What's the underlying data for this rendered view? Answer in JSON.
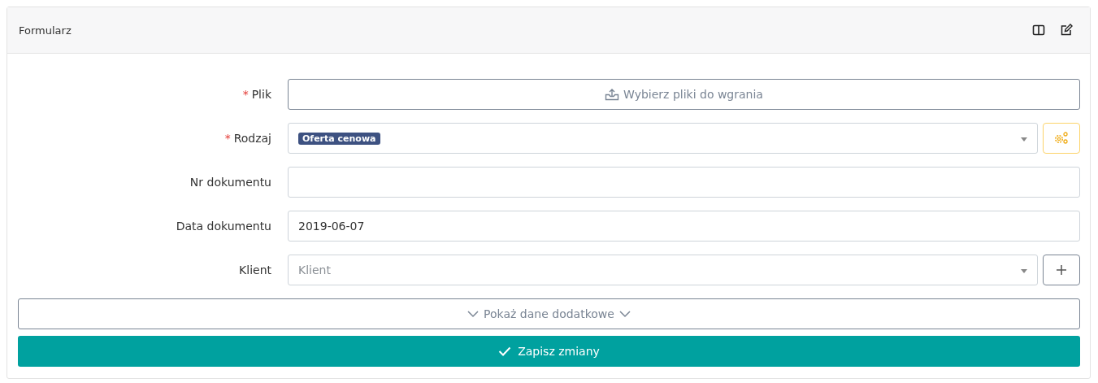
{
  "card": {
    "title": "Formularz"
  },
  "fields": [
    {
      "kind": "upload",
      "label": "Plik",
      "required_mark": "*",
      "button": "Wybierz pliki do wgrania"
    },
    {
      "kind": "tag-select",
      "label": "Rodzaj",
      "required_mark": "*",
      "tag": "Oferta cenowa",
      "side_button": {
        "kind": "settings"
      }
    },
    {
      "kind": "text",
      "label": "Nr dokumentu"
    },
    {
      "kind": "text",
      "label": "Data dokumentu",
      "value": "2019-06-07"
    },
    {
      "kind": "select",
      "label": "Klient",
      "placeholder": "Klient",
      "side_button": {
        "kind": "add"
      }
    }
  ],
  "more_button": "Pokaż dane dodatkowe",
  "save_button": "Zapisz zmiany"
}
